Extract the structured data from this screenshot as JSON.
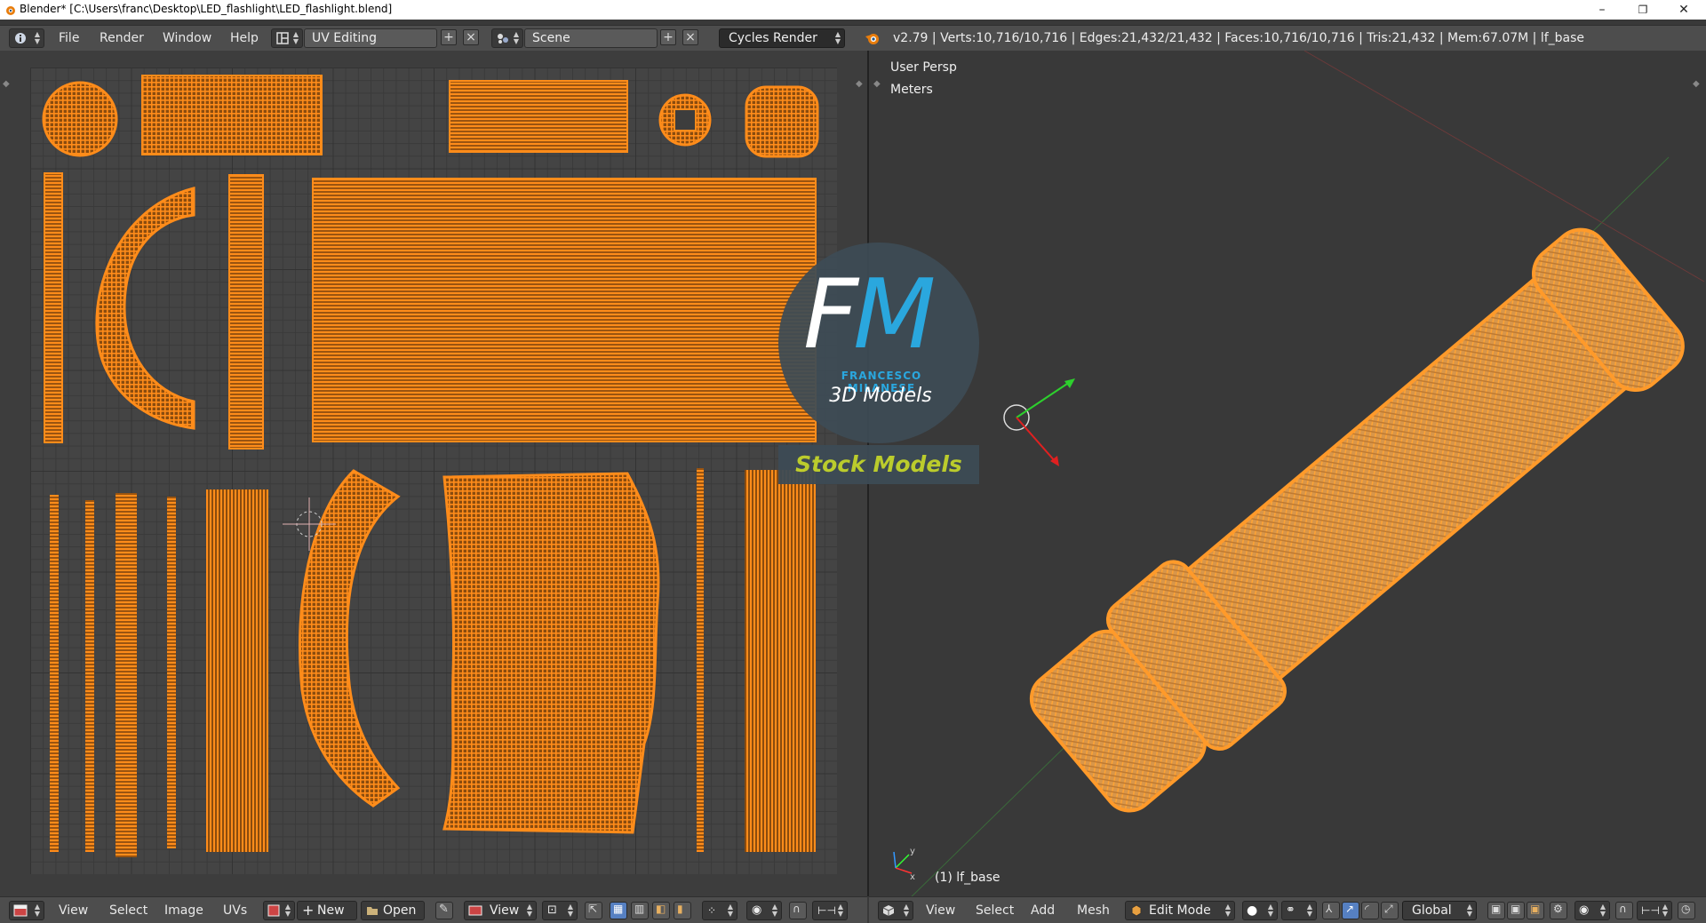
{
  "window": {
    "title": "Blender* [C:\\Users\\franc\\Desktop\\LED_flashlight\\LED_flashlight.blend]",
    "minimize": "–",
    "restore": "❐",
    "close": "✕"
  },
  "info_header": {
    "menus": [
      "File",
      "Render",
      "Window",
      "Help"
    ],
    "screen_layout": "UV Editing",
    "scene": "Scene",
    "render_engine": "Cycles Render",
    "stats": "v2.79 | Verts:10,716/10,716 | Edges:21,432/21,432 | Faces:10,716/10,716 | Tris:21,432 | Mem:67.07M | lf_base"
  },
  "viewport": {
    "view_name": "User Persp",
    "units": "Meters",
    "object_label": "(1) lf_base"
  },
  "watermark": {
    "letter_f": "F",
    "letter_m": "M",
    "brand": "FRANCESCO MILANESE",
    "subtitle": "3D Models",
    "banner": "Stock Models"
  },
  "uv_header": {
    "menus": [
      "View",
      "Select",
      "Image",
      "UVs"
    ],
    "new_label": "New",
    "open_label": "Open",
    "view_label": "View"
  },
  "view3d_header": {
    "menus": [
      "View",
      "Select",
      "Add",
      "Mesh"
    ],
    "mode": "Edit Mode",
    "orientation": "Global"
  },
  "colors": {
    "uv_orange": "#ff8c1a",
    "watermark_blue": "#2aa7de",
    "watermark_green": "#c2d42c"
  }
}
